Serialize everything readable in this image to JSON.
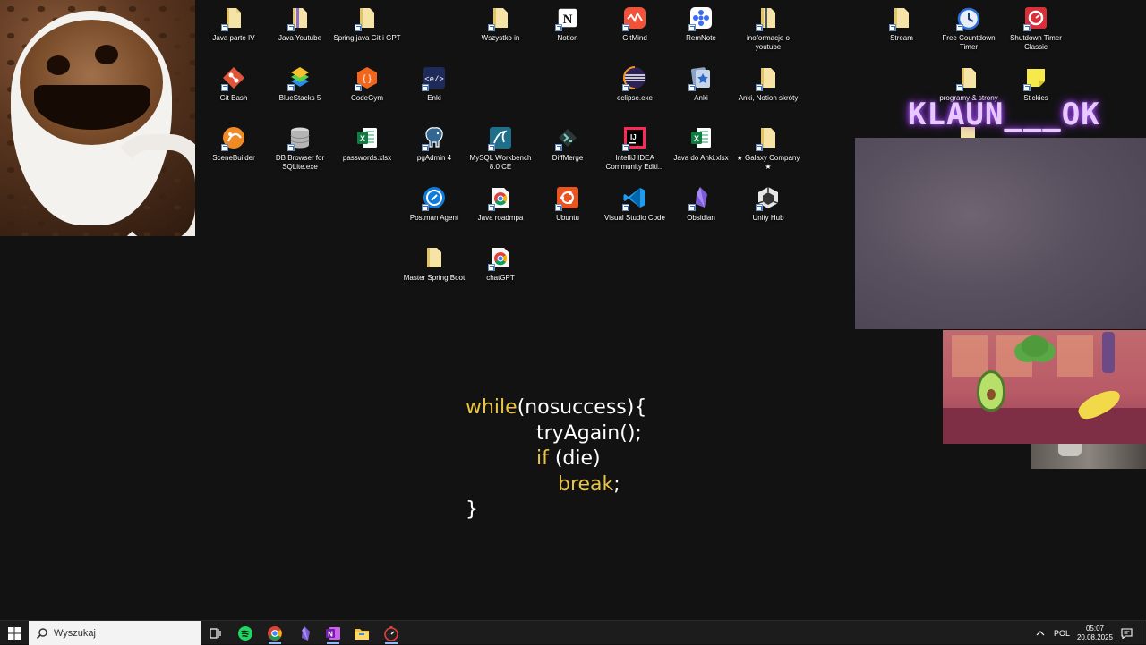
{
  "desktop": {
    "icons": {
      "java_parte_iv": "Java parte IV",
      "java_youtube": "Java Youtube",
      "spring_java_git_gpt": "Spring java Git i GPT",
      "wszystko_in": "Wszystko in",
      "notion": "Notion",
      "gitmind": "GitMind",
      "remnote": "RemNote",
      "inoformacje_youtube": "inoformacje o youtube",
      "stream": "Stream",
      "free_countdown_timer": "Free Countdown Timer",
      "shutdown_timer_classic": "Shutdown Timer Classic",
      "git_bash": "Git Bash",
      "bluestacks": "BlueStacks 5",
      "codegym": "CodeGym",
      "enki": "Enki",
      "eclipse": "eclipse.exe",
      "anki": "Anki",
      "anki_notion_skroty": "Anki, Notion skróty",
      "programy_strony": "programy & strony",
      "stickies": "Stickies",
      "scenebuilder": "SceneBuilder",
      "db_browser": "DB Browser for SQLite.exe",
      "passwords": "passwords.xlsx",
      "pgadmin": "pgAdmin 4",
      "mysql_workbench": "MySQL Workbench 8.0 CE",
      "diffmerge": "DiffMerge",
      "intellij": "IntelliJ IDEA Community Editi...",
      "java_do_anki": "Java do Anki.xlsx",
      "galaxy_company": "★ Galaxy Company ★",
      "postman_agent": "Postman Agent",
      "java_roadmpa": "Java roadmpa",
      "ubuntu": "Ubuntu",
      "vscode": "Visual Studio Code",
      "obsidian": "Obsidian",
      "unity_hub": "Unity Hub",
      "master_spring_boot": "Master Spring Boot",
      "chatgpt": "chatGPT"
    },
    "code": {
      "l1_kw": "while",
      "l1_rest": "(nosuccess){",
      "l2": "tryAgain();",
      "l3_kw": "if",
      "l3_rest": " (die)",
      "l4_kw": "break",
      "l4_rest": ";",
      "l5": "}"
    },
    "overlay_text": "KLAUN___OK"
  },
  "taskbar": {
    "search_placeholder": "Wyszukaj",
    "language": "POL",
    "time": "05:07",
    "date": "20.08.2025",
    "accent_color": "#8fb9ff"
  },
  "colors": {
    "background": "#121212",
    "code_keyword": "#e8c547",
    "code_text": "#ffffff",
    "taskbar": "#1c1c1c"
  }
}
